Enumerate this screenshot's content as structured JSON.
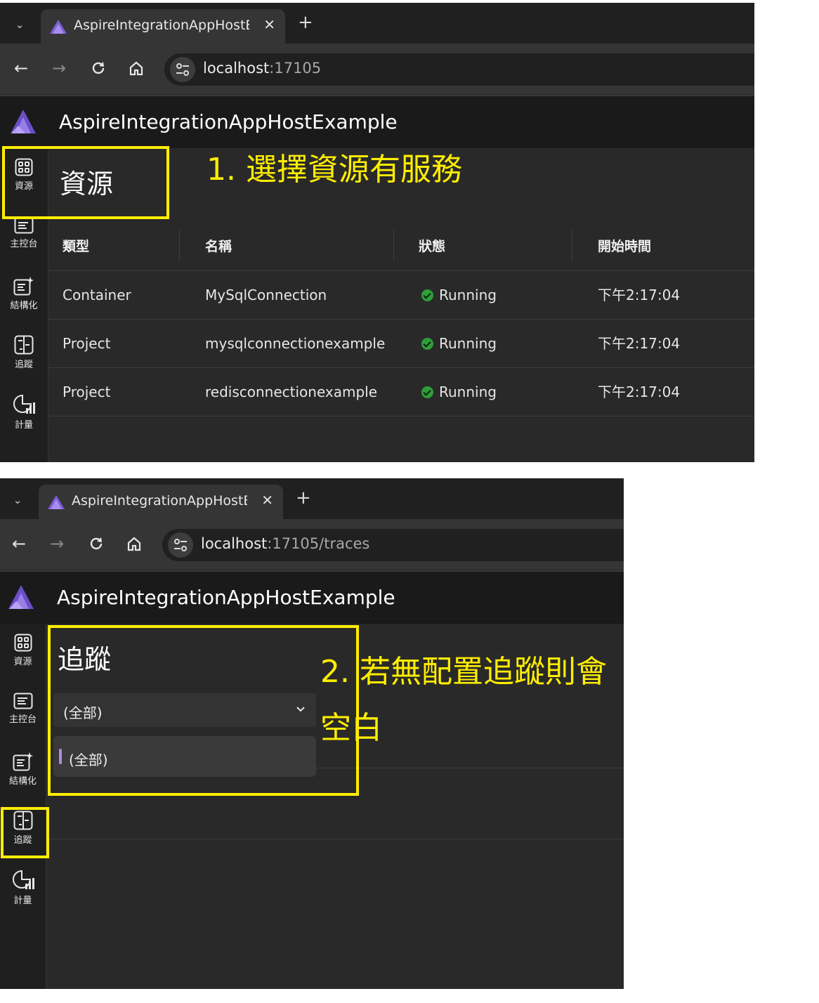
{
  "colors": {
    "annotation": "#ffee00",
    "running": "#2e9e3a",
    "accent": "#b08be0"
  },
  "browser": {
    "tab_title": "AspireIntegrationAppHostExa",
    "new_tab": "+",
    "close": "✕"
  },
  "app": {
    "title": "AspireIntegrationAppHostExample"
  },
  "sidebar": {
    "items": [
      {
        "label": "資源",
        "icon": "grid-icon"
      },
      {
        "label": "主控台",
        "icon": "console-icon"
      },
      {
        "label": "結構化",
        "icon": "structured-log-icon"
      },
      {
        "label": "追蹤",
        "icon": "traces-icon"
      },
      {
        "label": "計量",
        "icon": "metrics-icon"
      }
    ]
  },
  "screen1": {
    "url_host": "localhost",
    "url_rest": ":17105",
    "page_title": "資源",
    "annotation": "1. 選擇資源有服務",
    "columns": [
      "類型",
      "名稱",
      "狀態",
      "開始時間"
    ],
    "rows": [
      {
        "type": "Container",
        "name": "MySqlConnection",
        "status": "Running",
        "start": "下午2:17:04"
      },
      {
        "type": "Project",
        "name": "mysqlconnectionexample",
        "status": "Running",
        "start": "下午2:17:04"
      },
      {
        "type": "Project",
        "name": "redisconnectionexample",
        "status": "Running",
        "start": "下午2:17:04"
      }
    ]
  },
  "screen2": {
    "url_host": "localhost",
    "url_rest": ":17105/traces",
    "page_title": "追蹤",
    "select_value": "(全部)",
    "dropdown_option": "(全部)",
    "annotation_line1": "2. 若無配置追蹤則會",
    "annotation_line2": "空白"
  }
}
